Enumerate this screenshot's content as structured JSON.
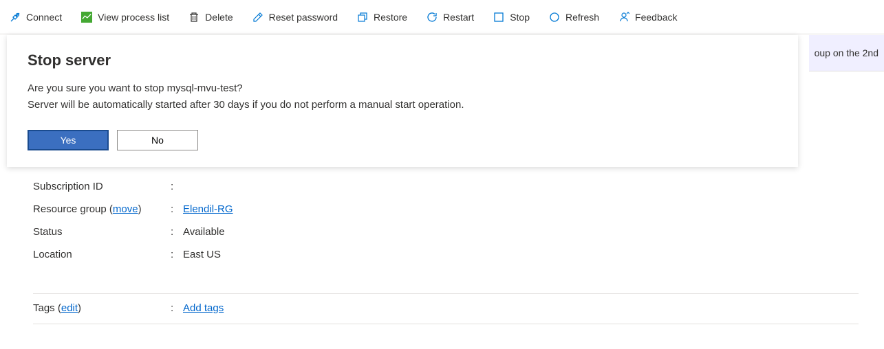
{
  "toolbar": {
    "connect": "Connect",
    "view_process_list": "View process list",
    "delete": "Delete",
    "reset_password": "Reset password",
    "restore": "Restore",
    "restart": "Restart",
    "stop": "Stop",
    "refresh": "Refresh",
    "feedback": "Feedback"
  },
  "dialog": {
    "title": "Stop server",
    "message_line1": "Are you sure you want to stop mysql-mvu-test?",
    "message_line2": "Server will be automatically started after 30 days if you do not perform a manual start operation.",
    "yes": "Yes",
    "no": "No"
  },
  "banner": {
    "partial_text": "oup on the 2nd"
  },
  "details": {
    "subscription_id": {
      "label": "Subscription ID",
      "value": ""
    },
    "resource_group": {
      "label": "Resource group",
      "move_text": "move",
      "value": "Elendil-RG"
    },
    "status": {
      "label": "Status",
      "value": "Available"
    },
    "location": {
      "label": "Location",
      "value": "East US"
    },
    "tags": {
      "label": "Tags",
      "edit_text": "edit",
      "add_tags": "Add tags"
    }
  }
}
